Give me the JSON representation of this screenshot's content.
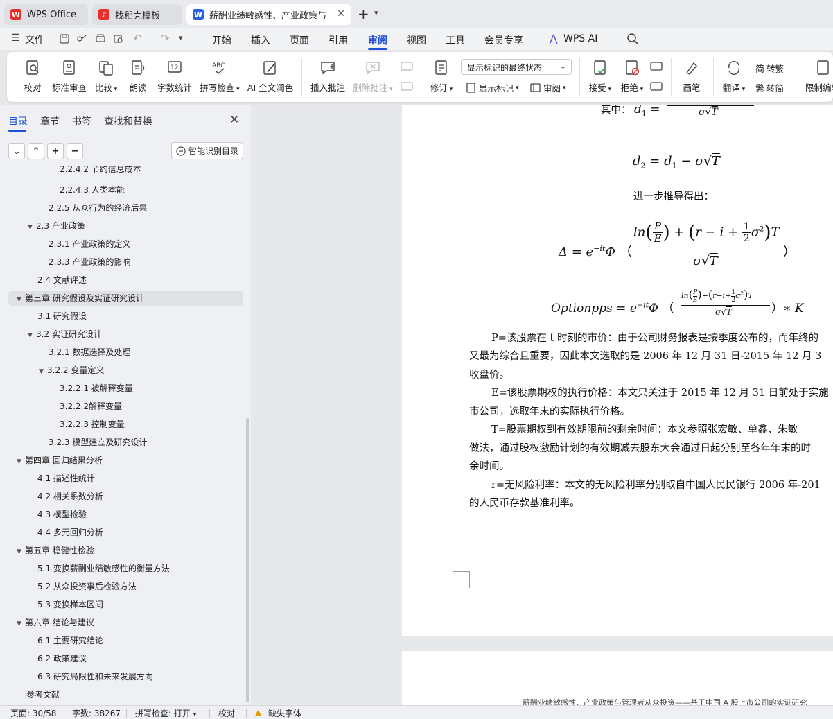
{
  "tabs": [
    {
      "label": "WPS Office"
    },
    {
      "label": "找稻壳模板"
    },
    {
      "label": "薪酬业绩敏感性、产业政策与管"
    }
  ],
  "menu": {
    "file": "文件",
    "items": [
      "开始",
      "插入",
      "页面",
      "引用",
      "审阅",
      "视图",
      "工具",
      "会员专享",
      "WPS AI"
    ]
  },
  "ribbon": {
    "proofread": "校对",
    "std_review": "标准审查",
    "compare": "比较",
    "read_aloud": "朗读",
    "word_count": "字数统计",
    "spell_check": "拼写检查",
    "ai_polish": "AI 全文润色",
    "insert_comment": "插入批注",
    "delete_comment": "删除批注",
    "track_changes": "修订",
    "markup_state": "显示标记的最终状态",
    "show_markup": "显示标记",
    "review": "审阅",
    "accept": "接受",
    "reject": "拒绝",
    "pen": "画笔",
    "translate": "翻译",
    "to_traditional": "转繁",
    "to_simplified": "转简",
    "restrict_edit": "限制编辑"
  },
  "sidebar": {
    "tabs": [
      "目录",
      "章节",
      "书签",
      "查找和替换"
    ],
    "smart_btn": "智能识别目录",
    "toc": [
      {
        "label": "2.2.4.2  节约信息成本"
      },
      {
        "label": "2.2.4.3  人类本能"
      },
      {
        "label": "2.2.5  从众行为的经济后果"
      },
      {
        "label": "2.3  产业政策"
      },
      {
        "label": "2.3.1  产业政策的定义"
      },
      {
        "label": "2.3.3  产业政策的影响"
      },
      {
        "label": "2.4  文献评述"
      },
      {
        "label": "第三章  研究假设及实证研究设计"
      },
      {
        "label": "3.1  研究假设"
      },
      {
        "label": "3.2  实证研究设计"
      },
      {
        "label": "3.2.1  数据选择及处理"
      },
      {
        "label": "3.2.2  变量定义"
      },
      {
        "label": "3.2.2.1  被解释变量"
      },
      {
        "label": "3.2.2.2解释变量"
      },
      {
        "label": "3.2.2.3  控制变量"
      },
      {
        "label": "3.2.3  模型建立及研究设计"
      },
      {
        "label": "第四章  回归结果分析"
      },
      {
        "label": "4.1  描述性统计"
      },
      {
        "label": "4.2  相关系数分析"
      },
      {
        "label": "4.3  模型检验"
      },
      {
        "label": "4.4  多元回归分析"
      },
      {
        "label": "第五章  稳健性检验"
      },
      {
        "label": "5.1  变换薪酬业绩敏感性的衡量方法"
      },
      {
        "label": "5.2  从众投资事后检验方法"
      },
      {
        "label": "5.3  变换样本区间"
      },
      {
        "label": "第六章  结论与建议"
      },
      {
        "label": "6.1  主要研究结论"
      },
      {
        "label": "6.2  政策建议"
      },
      {
        "label": "6.3  研究局限性和未来发展方向"
      },
      {
        "label": "参考文献"
      }
    ]
  },
  "doc": {
    "where_prefix": "其中：",
    "further_derive": "进一步推导得出：",
    "paragraphs": [
      "P=该股票在 t 时刻的市价：由于公司财务报表是按季度公布的，而年终的",
      "又最为综合且重要，因此本文选取的是 2006 年 12 月 31 日-2015 年 12 月 3",
      "收盘价。",
      "E=该股票期权的执行价格：本文只关注于 2015 年 12 月 31 日前处于实施",
      "市公司，选取年末的实际执行价格。",
      "T=股票期权到有效期限前的剩余时间：本文参照张宏敏、单鑫、朱敏",
      "做法，通过股权激励计划的有效期减去股东大会通过日起分别至各年年末的时",
      "余时间。",
      "r=无风险利率：本文的无风险利率分别取自中国人民民银行 2006 年-201",
      "的人民币存款基准利率。"
    ],
    "page2_header": "薪酬业绩敏感性、产业政策与管理者从众投资——基于中国 A 股上市公司的实证研究"
  },
  "status": {
    "page": "页面: 30/58",
    "words": "字数: 38267",
    "spell": "拼写检查: 打开",
    "proof": "校对",
    "missing_font": "缺失字体"
  }
}
